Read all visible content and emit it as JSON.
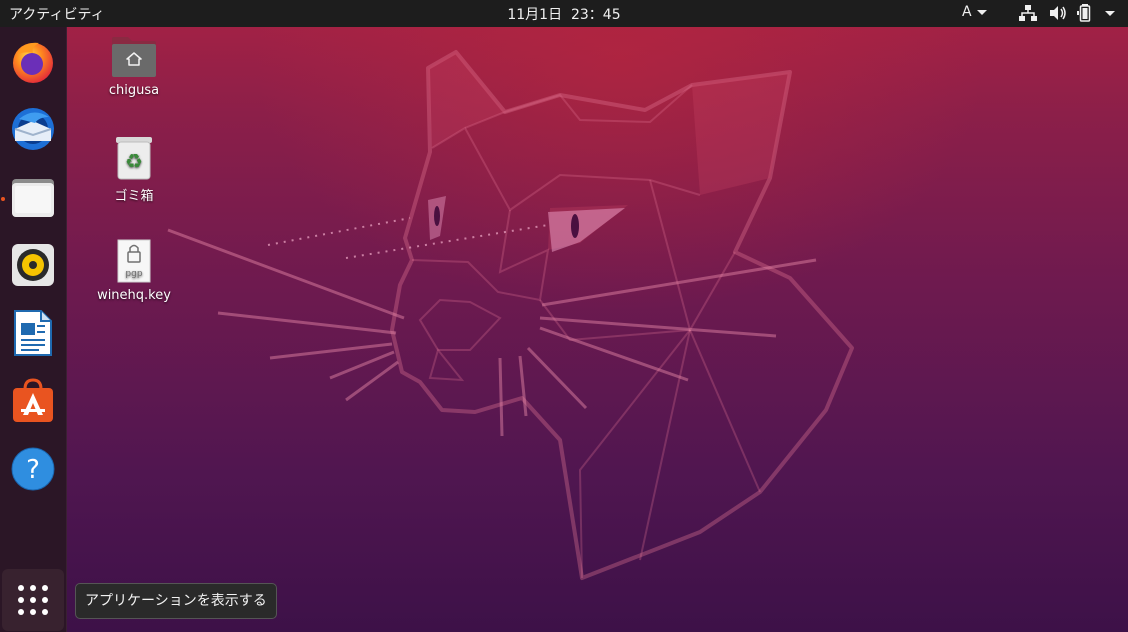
{
  "topbar": {
    "activities_label": "アクティビティ",
    "clock": "11月1日  23：45",
    "input_source": "A",
    "tray_icons": [
      "network-icon",
      "volume-icon",
      "battery-icon",
      "system-menu-caret-icon"
    ]
  },
  "dock": {
    "items": [
      {
        "name": "firefox",
        "icon": "firefox-icon",
        "running": false
      },
      {
        "name": "thunderbird",
        "icon": "thunderbird-icon",
        "running": false
      },
      {
        "name": "files",
        "icon": "files-icon",
        "running": true
      },
      {
        "name": "rhythmbox",
        "icon": "rhythmbox-icon",
        "running": false
      },
      {
        "name": "libreoffice-writer",
        "icon": "writer-icon",
        "running": false
      },
      {
        "name": "ubuntu-software",
        "icon": "software-center-icon",
        "running": false
      },
      {
        "name": "help",
        "icon": "help-icon",
        "running": false
      }
    ],
    "show_apps_icon": "app-grid-icon"
  },
  "desktop": {
    "icons": [
      {
        "label": "chigusa",
        "icon": "home-folder-icon"
      },
      {
        "label": "ゴミ箱",
        "icon": "trash-icon"
      },
      {
        "label": "winehq.key",
        "icon": "pgp-key-file-icon",
        "file_badge": "pgp"
      }
    ]
  },
  "tooltip": {
    "text": "アプリケーションを表示する"
  },
  "colors": {
    "accent": "#e95420",
    "topbar_bg": "#1d1d1d",
    "dock_bg": "#2b1626",
    "wallpaper_top": "#a82244",
    "wallpaper_bottom": "#3d1148"
  }
}
